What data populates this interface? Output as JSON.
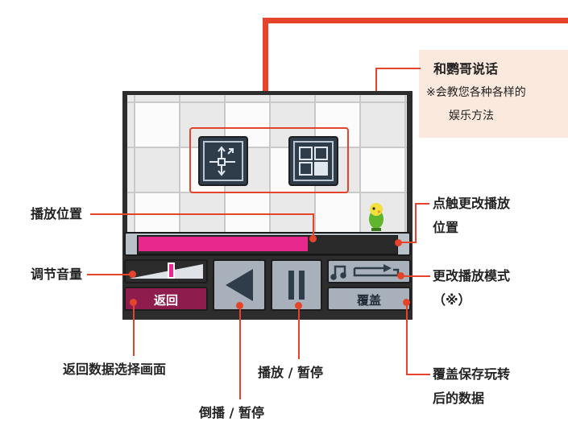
{
  "labels": {
    "talk_title": "和鹦哥说话",
    "talk_note_1": "※会教您各种各样的",
    "talk_note_2": "娱乐方法",
    "play_position": "播放位置",
    "touch_change_1": "点触更改播放",
    "touch_change_2": "位置",
    "volume": "调节音量",
    "change_mode_1": "更改播放模式",
    "change_mode_2": "（※）",
    "return_select": "返回数据选择画面",
    "play_pause": "播放 / 暂停",
    "overwrite_1": "覆盖保存玩转",
    "overwrite_2": "后的数据",
    "rewind_pause": "倒播 / 暂停"
  },
  "screen": {
    "back_button": "返回",
    "overwrite_button": "覆盖",
    "progress_fraction": 0.66,
    "volume_fraction": 0.55
  },
  "colors": {
    "accent": "#e4452a",
    "progress": "#e8288c",
    "back_button_bg": "#8e1d4e",
    "callout_bg": "#fbe9de"
  }
}
